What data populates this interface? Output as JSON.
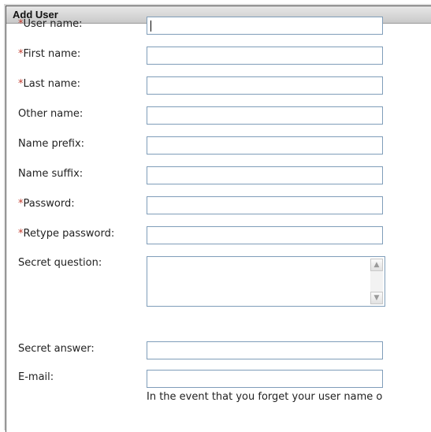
{
  "dialog": {
    "title": "Add User"
  },
  "required_marker": "*",
  "fields": [
    {
      "label": "User name:",
      "required": true,
      "value": ""
    },
    {
      "label": "First name:",
      "required": true,
      "value": ""
    },
    {
      "label": "Last name:",
      "required": true,
      "value": ""
    },
    {
      "label": "Other name:",
      "required": false,
      "value": ""
    },
    {
      "label": "Name prefix:",
      "required": false,
      "value": ""
    },
    {
      "label": "Name suffix:",
      "required": false,
      "value": ""
    },
    {
      "label": "Password:",
      "required": true,
      "value": ""
    },
    {
      "label": "Retype password:",
      "required": true,
      "value": ""
    },
    {
      "label": "Secret question:",
      "required": false,
      "value": ""
    },
    {
      "label": "Secret answer:",
      "required": false,
      "value": ""
    },
    {
      "label": "E-mail:",
      "required": false,
      "value": ""
    }
  ],
  "email_note": "In the event that you forget your user name o",
  "colors": {
    "required_marker": "#c0392b",
    "field_border": "#7f9db9",
    "header_bg": "#d4d4d4"
  },
  "icons": {
    "scroll_up": "chevron-up-icon",
    "scroll_down": "chevron-down-icon"
  }
}
